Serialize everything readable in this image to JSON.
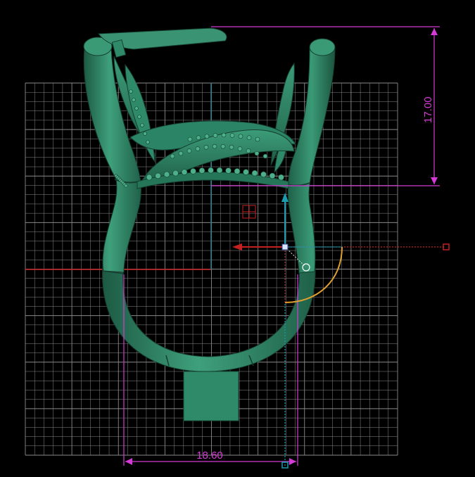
{
  "viewport": {
    "background": "#000000",
    "grid_color": "#8a8a8a",
    "axis_x_color": "#c42020",
    "axis_y_color": "#1f7f8f",
    "model_color": "#2f8a6a"
  },
  "dimensions": {
    "height_label": "17.00",
    "width_label": "18.60",
    "color": "#d63ad6"
  },
  "gizmo": {
    "move_x_color": "#c42020",
    "move_y_color": "#1a9bb0",
    "rotate_arc_color": "#e0a030",
    "icons": [
      "move-x-arrow-icon",
      "move-y-arrow-icon",
      "rotate-arc-icon",
      "pivot-handle-icon"
    ]
  }
}
